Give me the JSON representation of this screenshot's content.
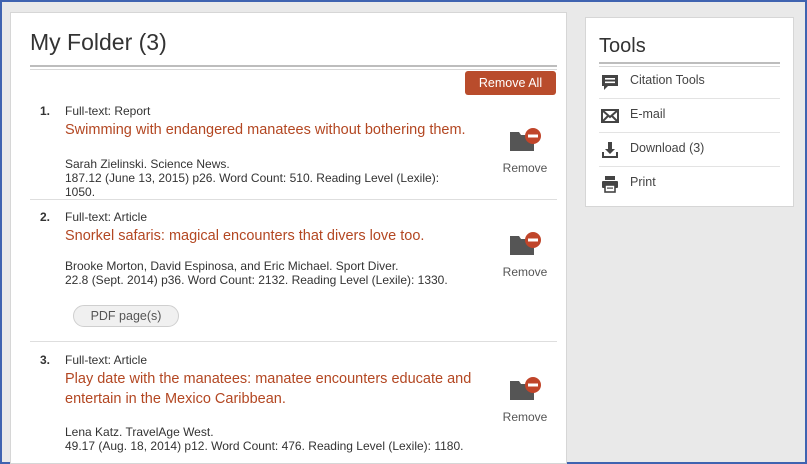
{
  "folder": {
    "title": "My Folder (3)",
    "remove_all_label": "Remove All",
    "remove_label": "Remove",
    "items": [
      {
        "number": "1.",
        "type": "Full-text: Report",
        "title": "Swimming with endangered manatees without bothering them.",
        "authors": "Sarah Zielinski. Science News.",
        "details": "187.12 (June 13, 2015) p26. Word Count: 510. Reading Level (Lexile): 1050."
      },
      {
        "number": "2.",
        "type": "Full-text: Article",
        "title": "Snorkel safaris: magical encounters that divers love too.",
        "authors": "Brooke Morton, David Espinosa, and Eric Michael. Sport Diver.",
        "details": "22.8 (Sept. 2014) p36. Word Count: 2132. Reading Level (Lexile): 1330.",
        "pdf_label": "PDF page(s)"
      },
      {
        "number": "3.",
        "type": "Full-text: Article",
        "title": "Play date with the manatees: manatee encounters educate and entertain in the Mexico Caribbean.",
        "authors": "Lena Katz. TravelAge West.",
        "details": "49.17 (Aug. 18, 2014) p12. Word Count: 476. Reading Level (Lexile): 1180."
      }
    ]
  },
  "tools": {
    "title": "Tools",
    "items": [
      {
        "label": "Citation Tools",
        "icon": "citation-icon"
      },
      {
        "label": "E-mail",
        "icon": "email-icon"
      },
      {
        "label": "Download (3)",
        "icon": "download-icon"
      },
      {
        "label": "Print",
        "icon": "print-icon"
      }
    ]
  },
  "colors": {
    "accent": "#b94c2c",
    "link": "#b34722",
    "frame": "#3f63b0"
  }
}
